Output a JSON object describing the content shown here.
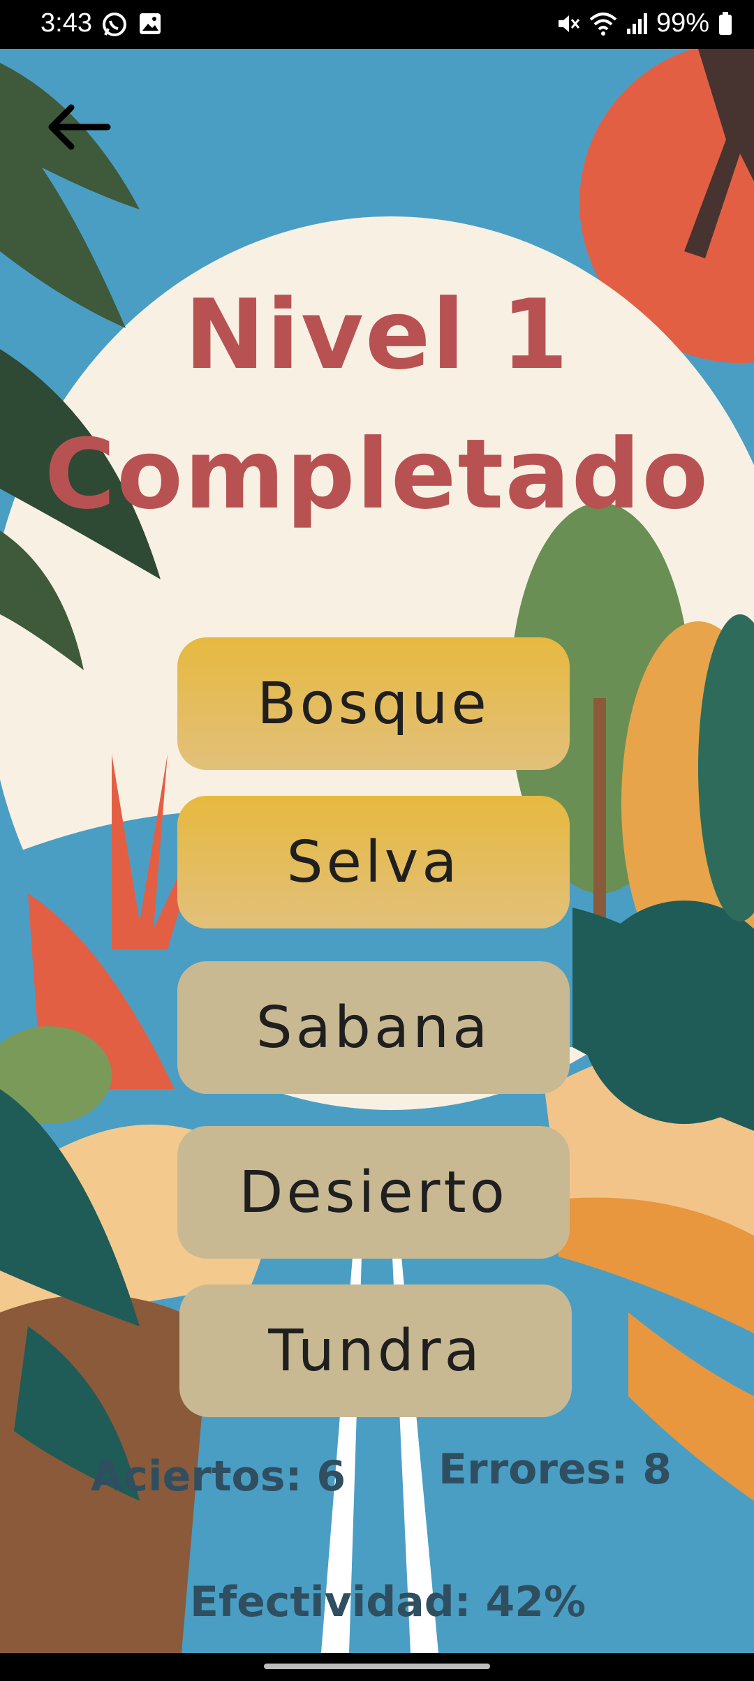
{
  "status_bar": {
    "time": "3:43",
    "battery": "99%"
  },
  "title": {
    "line1": "Nivel 1",
    "line2": "Completado"
  },
  "options": [
    {
      "label": "Bosque",
      "state": "selected"
    },
    {
      "label": "Selva",
      "state": "selected"
    },
    {
      "label": "Sabana",
      "state": "unselected"
    },
    {
      "label": "Desierto",
      "state": "unselected"
    },
    {
      "label": "Tundra",
      "state": "unselected"
    }
  ],
  "stats": {
    "aciertos": "Aciertos: 6",
    "errores": "Errores: 8",
    "efectividad": "Efectividad: 42%"
  },
  "colors": {
    "title": "#b85252",
    "option_selected": "#e6b93f",
    "option_default": "#c9b993",
    "stats_text": "#2f4f60",
    "sky": "#4a9ec4"
  }
}
